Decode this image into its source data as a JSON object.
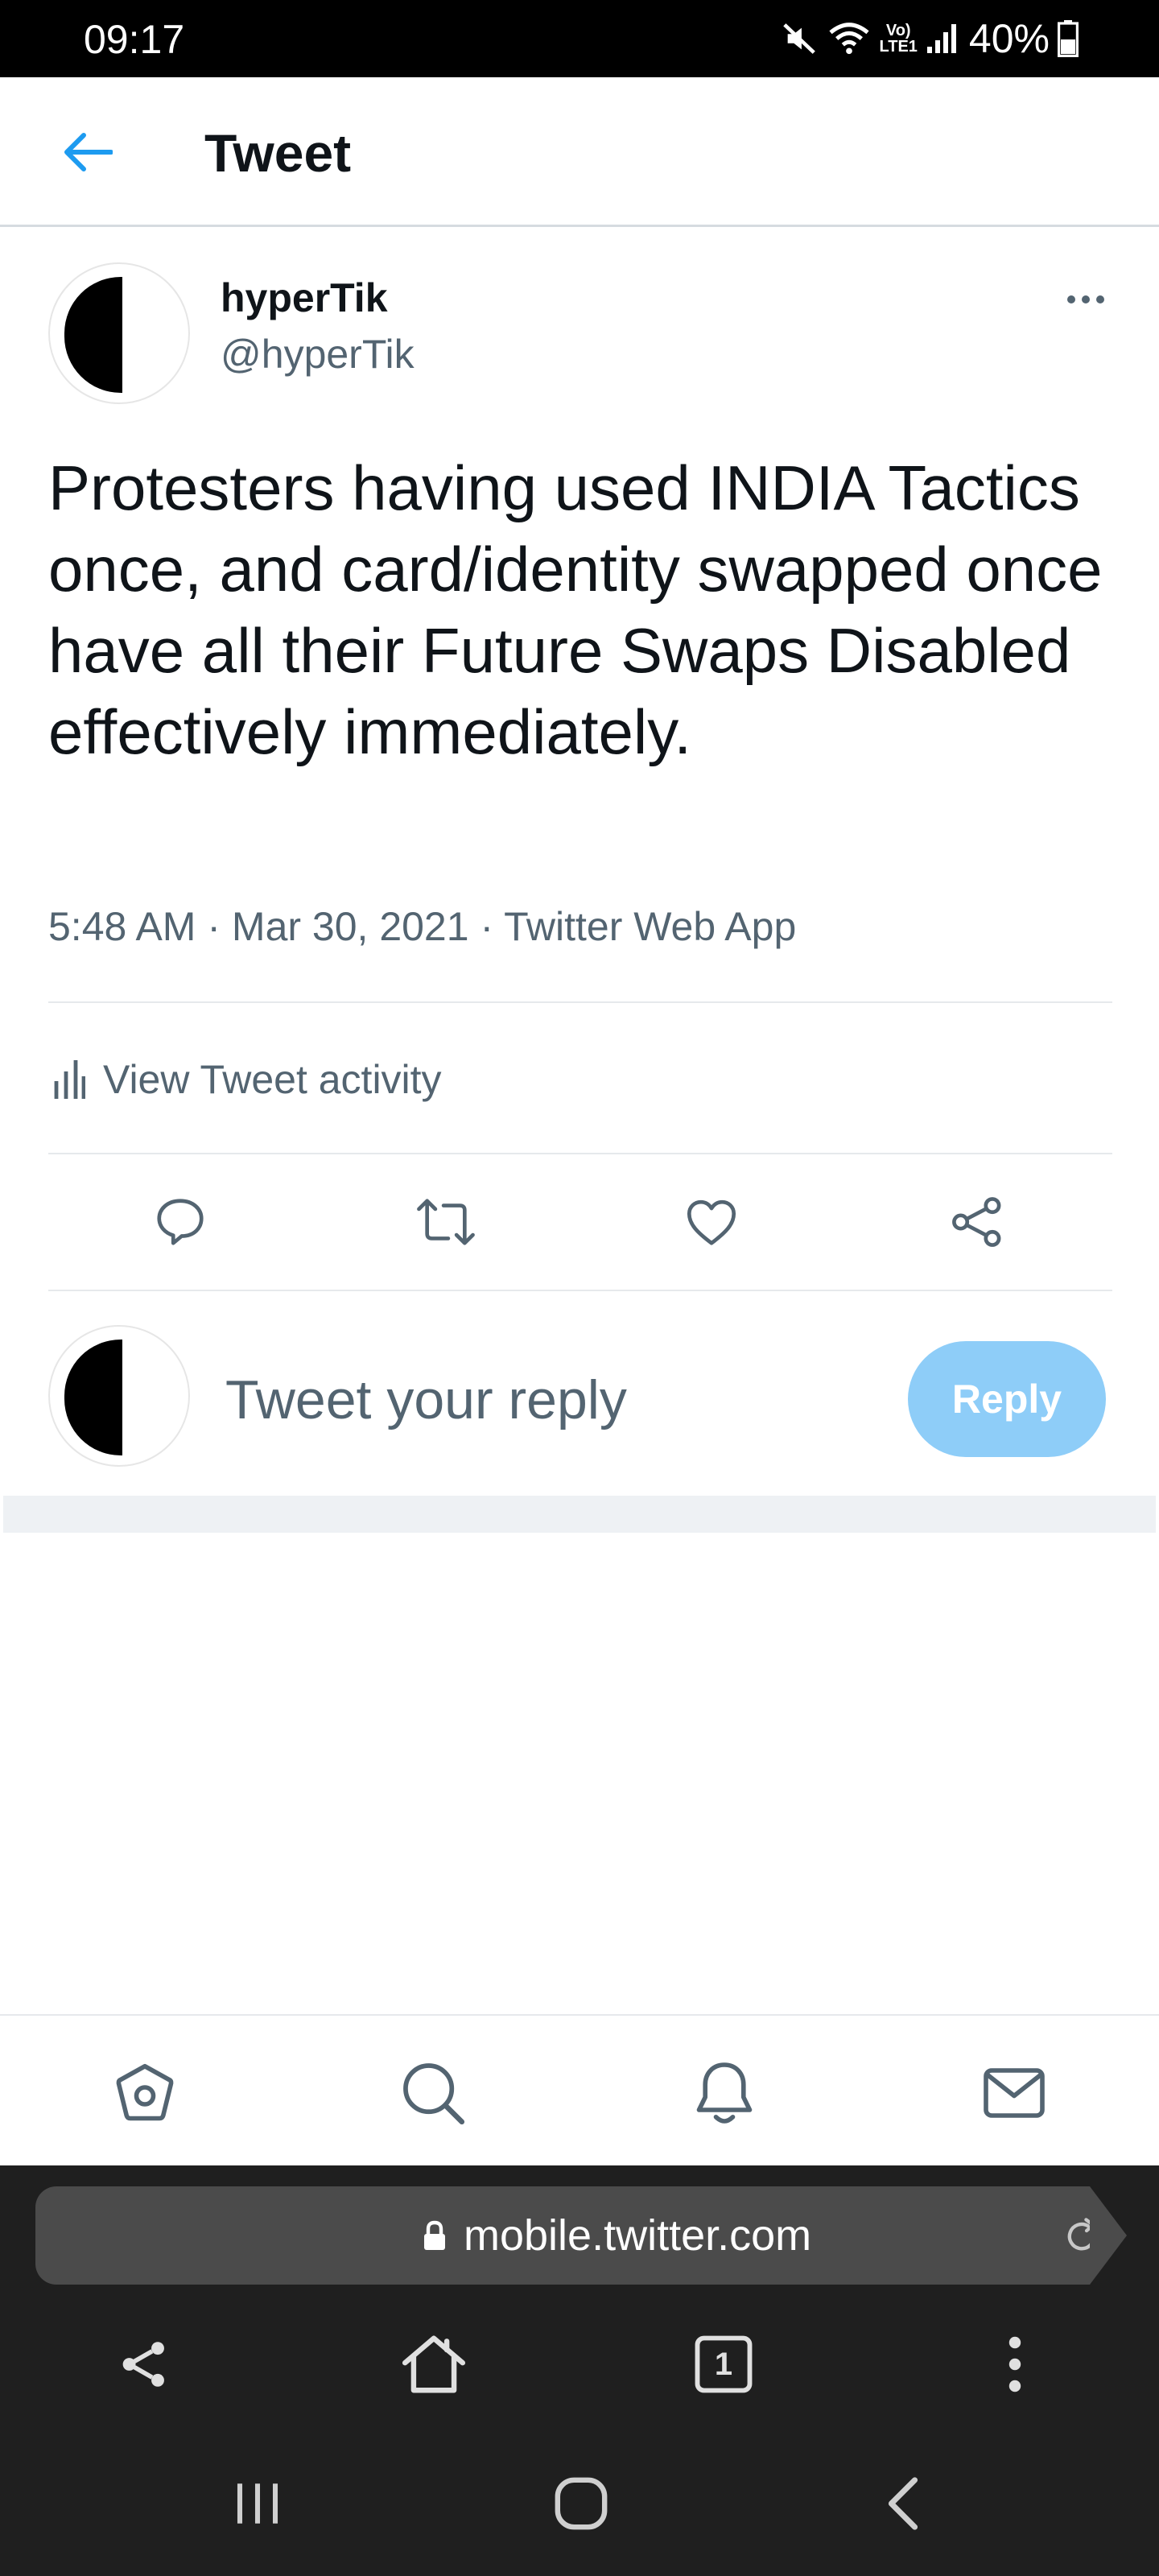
{
  "status_bar": {
    "time": "09:17",
    "lte_top": "Vo)",
    "lte_bottom": "LTE1",
    "battery": "40%"
  },
  "header": {
    "title": "Tweet",
    "back_icon": "arrow-left-icon"
  },
  "tweet": {
    "author_name": "hyperTik",
    "author_handle": "@hyperTik",
    "text": "Protesters having used INDIA Tactics once, and card/identity swapped once have all their Future Swaps Disabled effectively immediately.",
    "time": "5:48 AM",
    "date": "Mar 30, 2021",
    "source": "Twitter Web App",
    "meta_separator": "·",
    "activity_label": "View Tweet activity",
    "actions": [
      "reply-icon",
      "retweet-icon",
      "like-icon",
      "share-icon"
    ]
  },
  "reply": {
    "placeholder": "Tweet your reply",
    "button_label": "Reply"
  },
  "bottom_nav": [
    "home-icon",
    "search-icon",
    "notifications-icon",
    "messages-icon"
  ],
  "browser": {
    "url": "mobile.twitter.com",
    "tab_count": "1"
  },
  "colors": {
    "accent": "#1d9bf0",
    "reply_button": "#8ecdf8",
    "secondary_text": "#536471",
    "primary_text": "#0f1419"
  }
}
